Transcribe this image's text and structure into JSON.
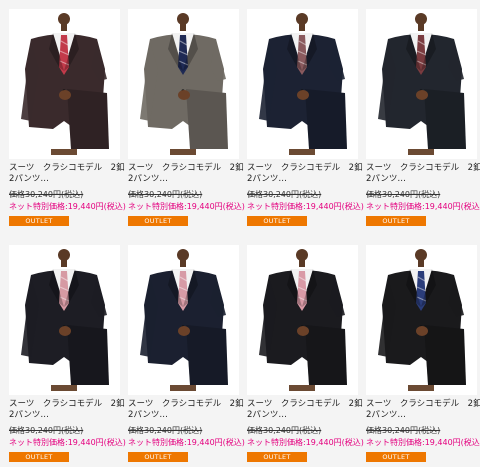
{
  "colors": {
    "outlet_badge": "#ee7700",
    "net_price": "#e4007f",
    "photo_bg": "#ffffff",
    "page_bg": "#f4f4f4"
  },
  "products": [
    {
      "title": "スーツ　クラシコモデル　2釦　2パンツ…",
      "price_old": "価格30,240円(税込)",
      "price_net": "ネット特別価格:19,440円(税込)",
      "badge": "OUTLET",
      "suit_color": "#3a2a2c",
      "tie_color": "#c23a4a",
      "tie_icon": "striped-tie"
    },
    {
      "title": "スーツ　クラシコモデル　2釦　2パンツ…",
      "price_old": "価格30,240円(税込)",
      "price_net": "ネット特別価格:19,440円(税込)",
      "badge": "OUTLET",
      "suit_color": "#6f6a63",
      "tie_color": "#1f2a55",
      "tie_icon": "striped-tie"
    },
    {
      "title": "スーツ　クラシコモデル　2釦　2パンツ…",
      "price_old": "価格30,240円(税込)",
      "price_net": "ネット特別価格:19,440円(税込)",
      "badge": "OUTLET",
      "suit_color": "#1c2233",
      "tie_color": "#8a5a5e",
      "tie_icon": "striped-tie"
    },
    {
      "title": "スーツ　クラシコモデル　2釦　2パンツ…",
      "price_old": "価格30,240円(税込)",
      "price_net": "ネット特別価格:19,440円(税込)",
      "badge": "OUTLET",
      "suit_color": "#22262e",
      "tie_color": "#7a3b3f",
      "tie_icon": "striped-tie"
    },
    {
      "title": "スーツ　クラシコモデル　2釦　2パンツ…",
      "price_old": "価格30,240円(税込)",
      "price_net": "ネット特別価格:19,440円(税込)",
      "badge": "OUTLET",
      "suit_color": "#1d1d24",
      "tie_color": "#d69aa3",
      "tie_icon": "striped-tie"
    },
    {
      "title": "スーツ　クラシコモデル　2釦　2パンツ…",
      "price_old": "価格30,240円(税込)",
      "price_net": "ネット特別価格:19,440円(税込)",
      "badge": "OUTLET",
      "suit_color": "#1b2030",
      "tie_color": "#d79ba6",
      "tie_icon": "striped-tie"
    },
    {
      "title": "スーツ　クラシコモデル　2釦　2パンツ…",
      "price_old": "価格30,240円(税込)",
      "price_net": "ネット特別価格:19,440円(税込)",
      "badge": "OUTLET",
      "suit_color": "#1b1b1f",
      "tie_color": "#d99aa6",
      "tie_icon": "striped-tie"
    },
    {
      "title": "スーツ　クラシコモデル　2釦　2パンツ…",
      "price_old": "価格30,240円(税込)",
      "price_net": "ネット特別価格:19,440円(税込)",
      "badge": "OUTLET",
      "suit_color": "#1a1a1c",
      "tie_color": "#2b3d7a",
      "tie_icon": "striped-tie"
    }
  ]
}
